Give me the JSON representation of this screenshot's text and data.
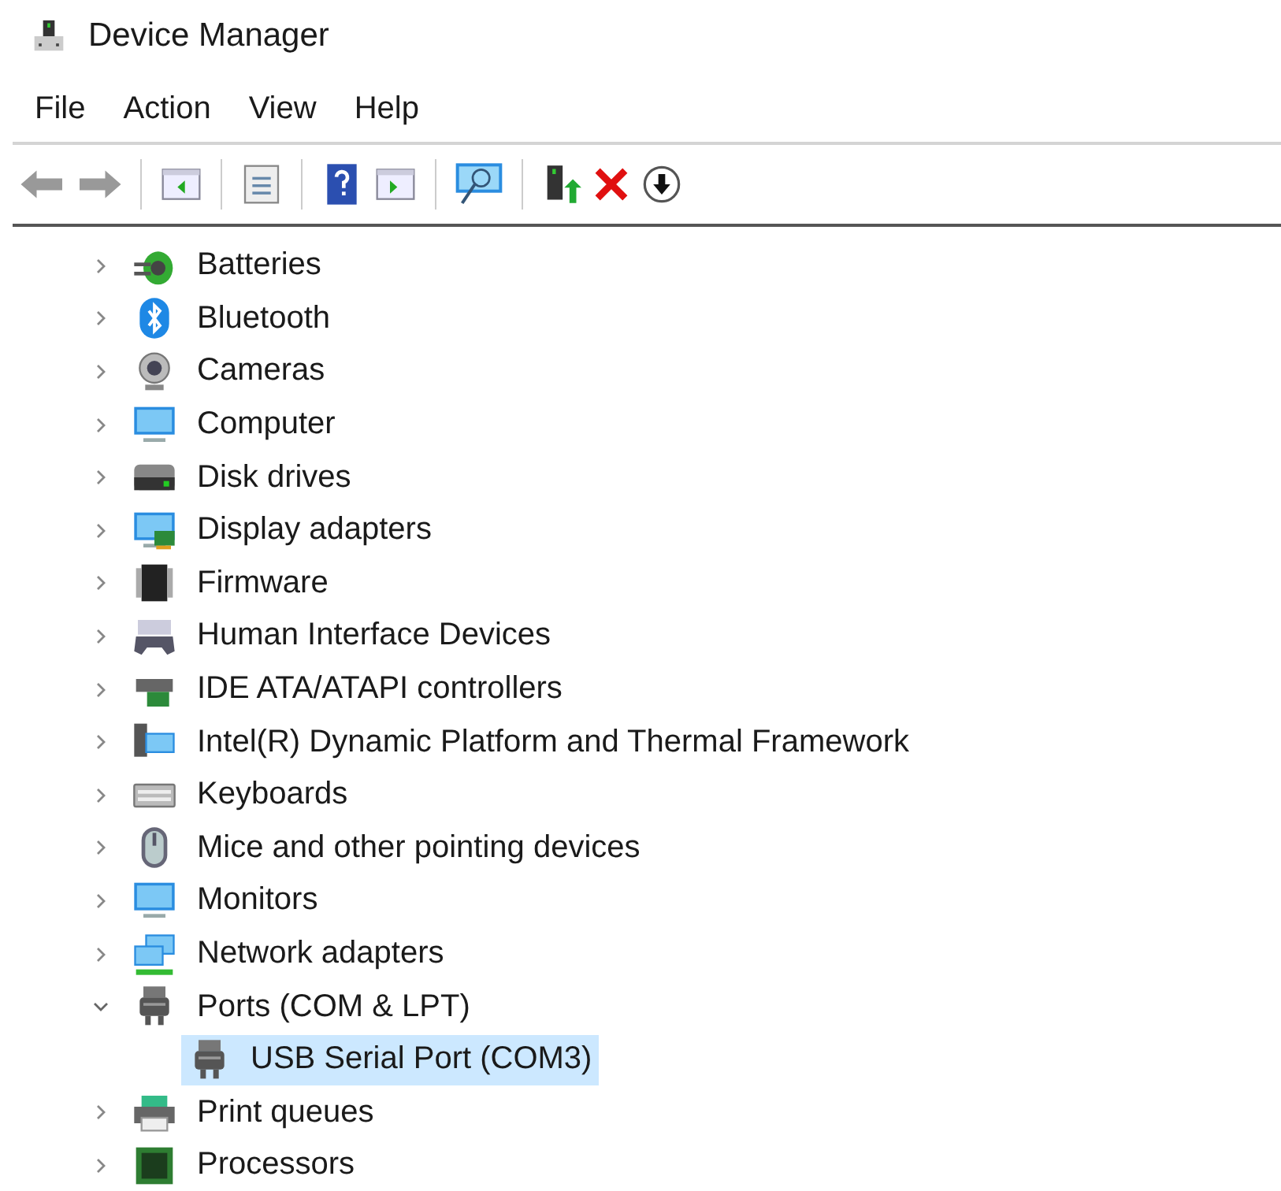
{
  "window": {
    "title": "Device Manager"
  },
  "menu": [
    "File",
    "Action",
    "View",
    "Help"
  ],
  "tree": {
    "items": [
      {
        "label": "Batteries",
        "expanded": false,
        "selected": false
      },
      {
        "label": "Bluetooth",
        "expanded": false,
        "selected": false
      },
      {
        "label": "Cameras",
        "expanded": false,
        "selected": false
      },
      {
        "label": "Computer",
        "expanded": false,
        "selected": false
      },
      {
        "label": "Disk drives",
        "expanded": false,
        "selected": false
      },
      {
        "label": "Display adapters",
        "expanded": false,
        "selected": false
      },
      {
        "label": "Firmware",
        "expanded": false,
        "selected": false
      },
      {
        "label": "Human Interface Devices",
        "expanded": false,
        "selected": false
      },
      {
        "label": "IDE ATA/ATAPI controllers",
        "expanded": false,
        "selected": false
      },
      {
        "label": "Intel(R) Dynamic Platform and Thermal Framework",
        "expanded": false,
        "selected": false
      },
      {
        "label": "Keyboards",
        "expanded": false,
        "selected": false
      },
      {
        "label": "Mice and other pointing devices",
        "expanded": false,
        "selected": false
      },
      {
        "label": "Monitors",
        "expanded": false,
        "selected": false
      },
      {
        "label": "Network adapters",
        "expanded": false,
        "selected": false
      },
      {
        "label": "Ports (COM & LPT)",
        "expanded": true,
        "selected": false,
        "children": [
          {
            "label": "USB Serial Port (COM3)",
            "selected": true
          }
        ]
      },
      {
        "label": "Print queues",
        "expanded": false,
        "selected": false
      },
      {
        "label": "Processors",
        "expanded": false,
        "selected": false
      }
    ]
  }
}
